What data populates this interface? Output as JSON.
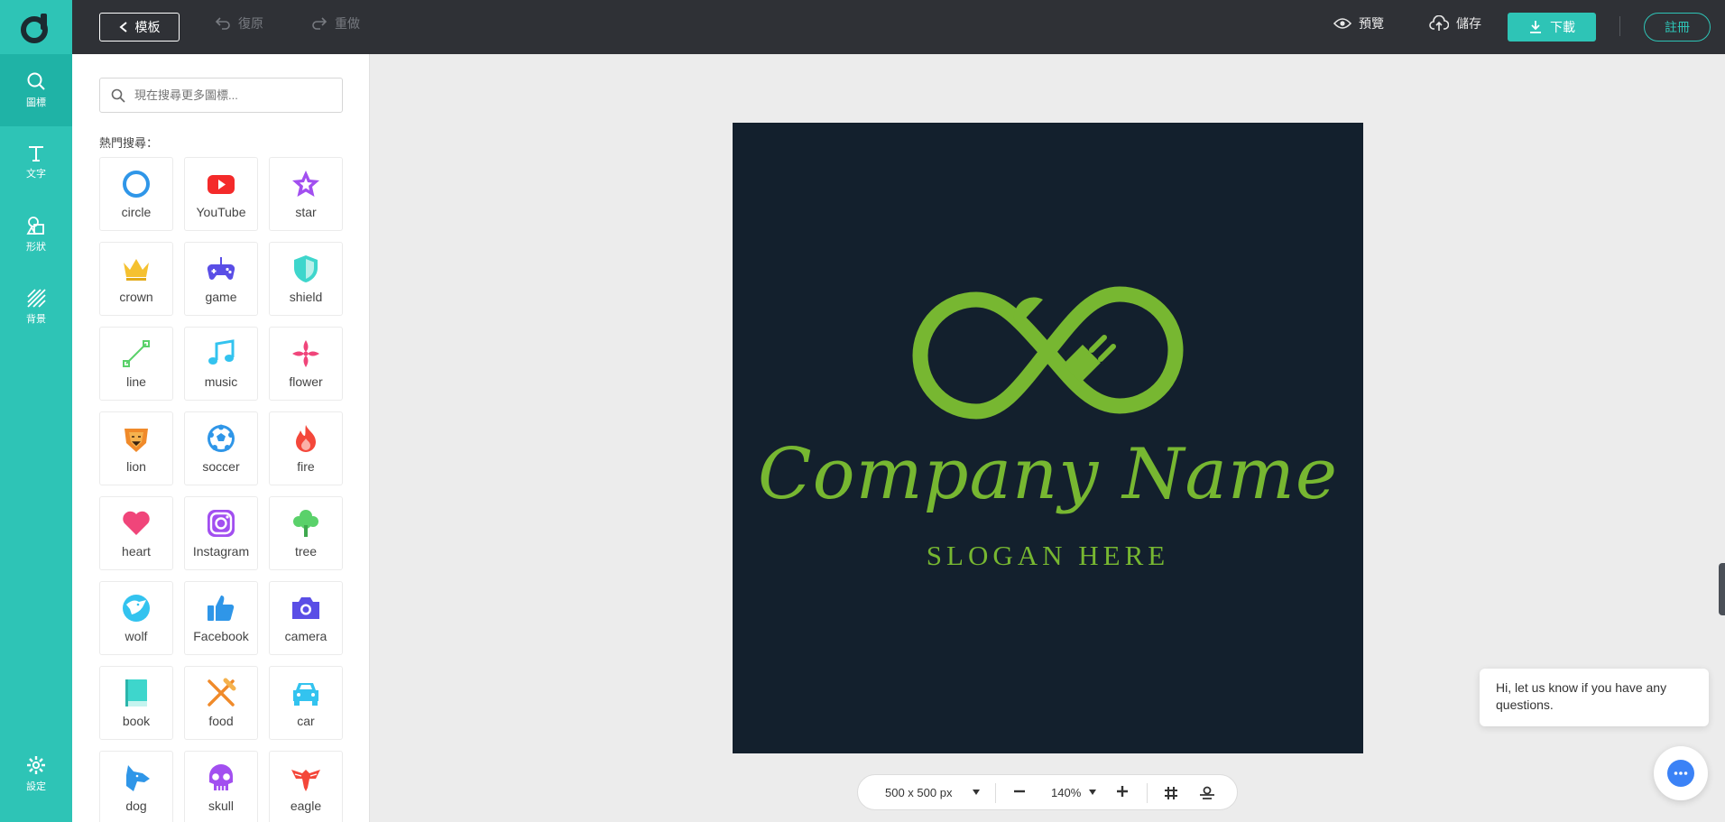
{
  "topbar": {
    "back_label": "模板",
    "undo_label": "復原",
    "redo_label": "重做",
    "preview_label": "預覽",
    "save_label": "儲存",
    "download_label": "下載",
    "register_label": "註冊"
  },
  "rail": {
    "items": [
      {
        "label": "圖標",
        "icon": "search-icon"
      },
      {
        "label": "文字",
        "icon": "text-icon"
      },
      {
        "label": "形狀",
        "icon": "shapes-icon"
      },
      {
        "label": "背景",
        "icon": "background-icon"
      }
    ],
    "settings_label": "設定"
  },
  "panel": {
    "search_placeholder": "現在搜尋更多圖標...",
    "hot_label": "熱門搜尋：",
    "icons": [
      {
        "label": "circle",
        "icon": "circle-icon",
        "color": "#2f96e8"
      },
      {
        "label": "YouTube",
        "icon": "youtube-icon",
        "color": "#f42a2a"
      },
      {
        "label": "star",
        "icon": "star-icon",
        "color": "#a24ff0"
      },
      {
        "label": "crown",
        "icon": "crown-icon",
        "color": "#f5c130"
      },
      {
        "label": "game",
        "icon": "gamepad-icon",
        "color": "#5a4ee6"
      },
      {
        "label": "shield",
        "icon": "shield-icon",
        "color": "#3ed6cc"
      },
      {
        "label": "line",
        "icon": "line-icon",
        "color": "#5ad16a"
      },
      {
        "label": "music",
        "icon": "music-icon",
        "color": "#33c3ef"
      },
      {
        "label": "flower",
        "icon": "flower-icon",
        "color": "#f0457a"
      },
      {
        "label": "lion",
        "icon": "lion-icon",
        "color": "#f08a2a"
      },
      {
        "label": "soccer",
        "icon": "soccer-icon",
        "color": "#2f96e8"
      },
      {
        "label": "fire",
        "icon": "fire-icon",
        "color": "#f4473a"
      },
      {
        "label": "heart",
        "icon": "heart-icon",
        "color": "#f0457a"
      },
      {
        "label": "Instagram",
        "icon": "instagram-icon",
        "color": "#a24ff0"
      },
      {
        "label": "tree",
        "icon": "tree-icon",
        "color": "#5ad16a"
      },
      {
        "label": "wolf",
        "icon": "wolf-icon",
        "color": "#33c3ef"
      },
      {
        "label": "Facebook",
        "icon": "thumbs-up-icon",
        "color": "#2f96e8"
      },
      {
        "label": "camera",
        "icon": "camera-icon",
        "color": "#5a4ee6"
      },
      {
        "label": "book",
        "icon": "book-icon",
        "color": "#3ed6cc"
      },
      {
        "label": "food",
        "icon": "fork-knife-icon",
        "color": "#f08a2a"
      },
      {
        "label": "car",
        "icon": "car-icon",
        "color": "#33c3ef"
      },
      {
        "label": "dog",
        "icon": "dog-icon",
        "color": "#2f96e8"
      },
      {
        "label": "skull",
        "icon": "skull-icon",
        "color": "#a24ff0"
      },
      {
        "label": "eagle",
        "icon": "eagle-icon",
        "color": "#f4473a"
      }
    ]
  },
  "canvas": {
    "company_name": "Company Name",
    "slogan": "SLOGAN HERE",
    "background": "#13202d",
    "accent": "#77b731"
  },
  "zoombar": {
    "size": "500 x 500 px",
    "zoom": "140%"
  },
  "chat": {
    "message": "Hi, let us know if you have any questions."
  }
}
